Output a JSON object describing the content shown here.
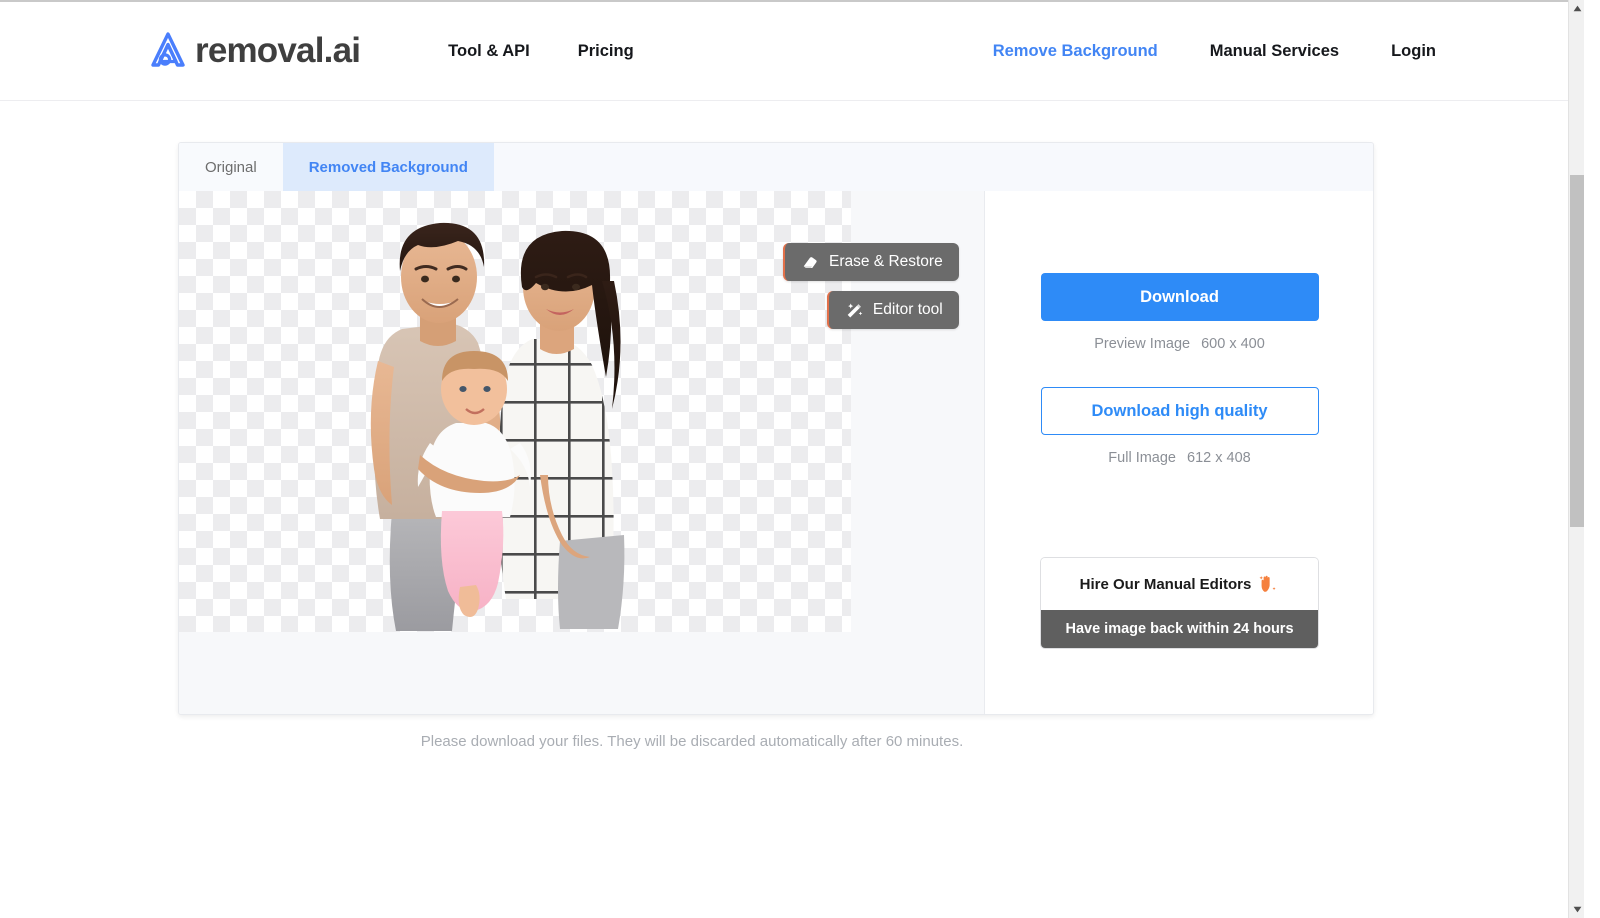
{
  "header": {
    "logo_text": "removal.ai",
    "logo_icon": "removal-ai-logo-icon",
    "nav_left": [
      {
        "label": "Tool & API"
      },
      {
        "label": "Pricing"
      }
    ],
    "nav_right": [
      {
        "label": "Remove Background",
        "accent": true
      },
      {
        "label": "Manual Services",
        "accent": false
      },
      {
        "label": "Login",
        "accent": false
      }
    ],
    "accent_color": "#4285f4"
  },
  "editor": {
    "tabs": [
      {
        "label": "Original",
        "active": false
      },
      {
        "label": "Removed Background",
        "active": true
      }
    ],
    "tools": [
      {
        "label": "Erase & Restore",
        "icon": "eraser-icon"
      },
      {
        "label": "Editor tool",
        "icon": "magic-wand-icon"
      }
    ],
    "canvas": {
      "transparency_checker": true,
      "image_alt": "family photo with background removed"
    }
  },
  "panel": {
    "download_label": "Download",
    "preview_label": "Preview Image",
    "preview_size": "600 x 400",
    "download_hq_label": "Download high quality",
    "full_label": "Full Image",
    "full_size": "612 x 408",
    "hire_title": "Hire Our Manual Editors",
    "hire_icon": "raised-hand-sparkle-icon",
    "hire_subtitle": "Have image back within 24 hours",
    "primary_color": "#2e8bf7"
  },
  "footer": {
    "note": "Please download your files. They will be discarded automatically after 60 minutes."
  },
  "scrollbar": {
    "up_icon": "scroll-up-arrow-icon",
    "down_icon": "scroll-down-arrow-icon"
  }
}
